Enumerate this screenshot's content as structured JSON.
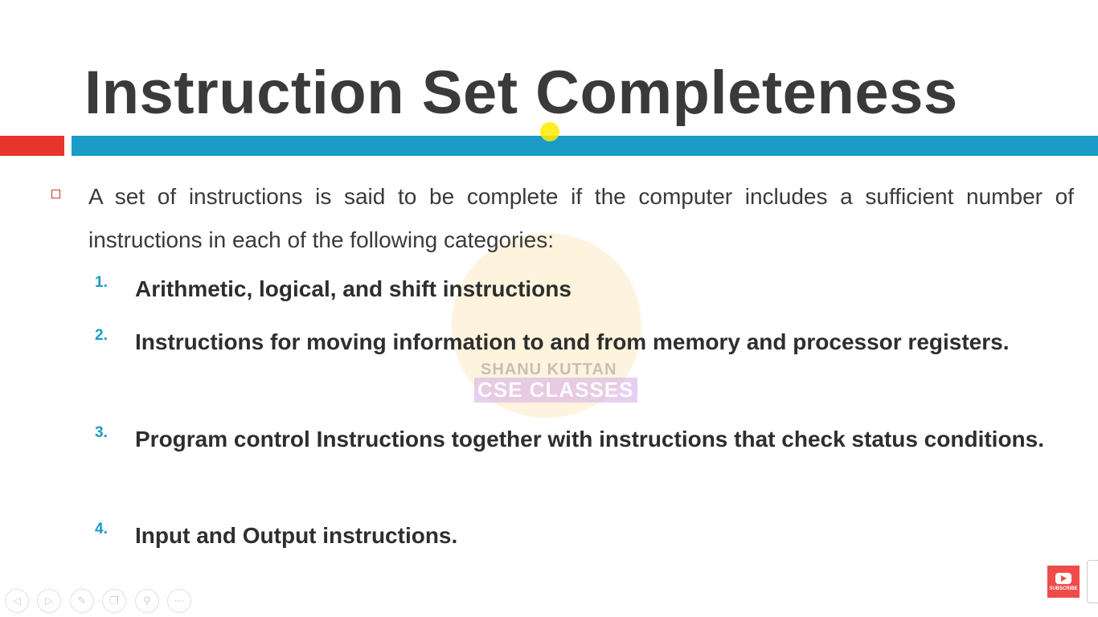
{
  "slide": {
    "title": "Instruction Set Completeness",
    "intro": "A set of instructions is said to be complete if the computer includes a sufficient number of instructions in each of the following categories:",
    "items": [
      {
        "num": "1.",
        "text": "Arithmetic, logical, and shift instructions"
      },
      {
        "num": "2.",
        "text": "Instructions for moving information to and from memory and processor registers."
      },
      {
        "num": "3.",
        "text": "Program control Instructions together with instructions that check status conditions."
      },
      {
        "num": "4.",
        "text": "Input and Output instructions."
      }
    ]
  },
  "watermark": {
    "line1": "SHANU KUTTAN",
    "line2": "CSE CLASSES"
  },
  "youtube": {
    "label": "SUBSCRIBE"
  },
  "colors": {
    "red": "#e8352b",
    "blue": "#1a9bc8",
    "text": "#3a3a3a"
  }
}
